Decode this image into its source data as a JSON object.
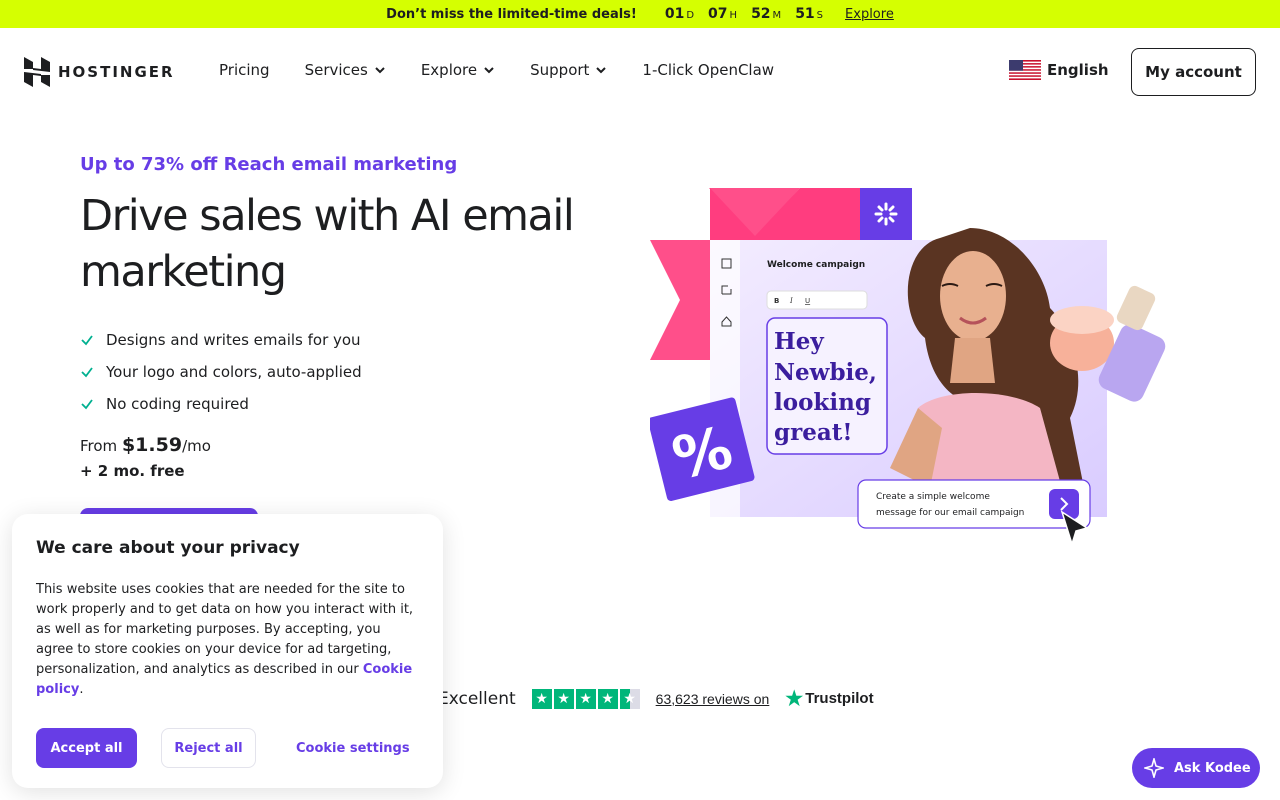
{
  "promo": {
    "message": "Don’t miss the limited-time deals!",
    "timer": [
      {
        "value": "01",
        "unit": "D"
      },
      {
        "value": "07",
        "unit": "H"
      },
      {
        "value": "52",
        "unit": "M"
      },
      {
        "value": "51",
        "unit": "S"
      }
    ],
    "link": "Explore"
  },
  "nav": {
    "logo": "HOSTINGER",
    "items": [
      {
        "label": "Pricing",
        "has_dropdown": false
      },
      {
        "label": "Services",
        "has_dropdown": true
      },
      {
        "label": "Explore",
        "has_dropdown": true
      },
      {
        "label": "Support",
        "has_dropdown": true
      },
      {
        "label": "1-Click OpenClaw",
        "has_dropdown": false
      }
    ],
    "language": "English",
    "account": "My account"
  },
  "hero": {
    "eyebrow": "Up to 73% off Reach email marketing",
    "headline": "Drive sales with AI email marketing",
    "features": [
      "Designs and writes emails for you",
      "Your logo and colors, auto-applied",
      "No coding required"
    ],
    "price_prefix": "From",
    "price": "$1.59",
    "price_suffix": "/mo",
    "price_extra": "+ 2 mo. free",
    "illustration": {
      "panel_title": "Welcome campaign",
      "toolbar": [
        "B",
        "I",
        "U"
      ],
      "greeting_lines": [
        "Hey",
        "Newbie,",
        "looking",
        "great!"
      ],
      "prompt_line1": "Create a simple welcome",
      "prompt_line2": "message for our email campaign",
      "badge": "%"
    }
  },
  "trust": {
    "rating_word": "Excellent",
    "reviews": "63,623 reviews on",
    "brand": "Trustpilot"
  },
  "cookie": {
    "title": "We care about your privacy",
    "body": "This website uses cookies that are needed for the site to work properly and to get data on how you interact with it, as well as for marketing purposes. By accepting, you agree to store cookies on your device for ad targeting, personalization, and analytics as described in our",
    "policy_link": "Cookie policy",
    "policy_end": ".",
    "accept": "Accept all",
    "reject": "Reject all",
    "settings": "Cookie settings"
  },
  "assistant": {
    "label": "Ask Kodee"
  },
  "colors": {
    "brand": "#673de6",
    "promo_bg": "#d5ff01",
    "trust_green": "#00b67a",
    "accent_pink": "#ff3d7f"
  }
}
